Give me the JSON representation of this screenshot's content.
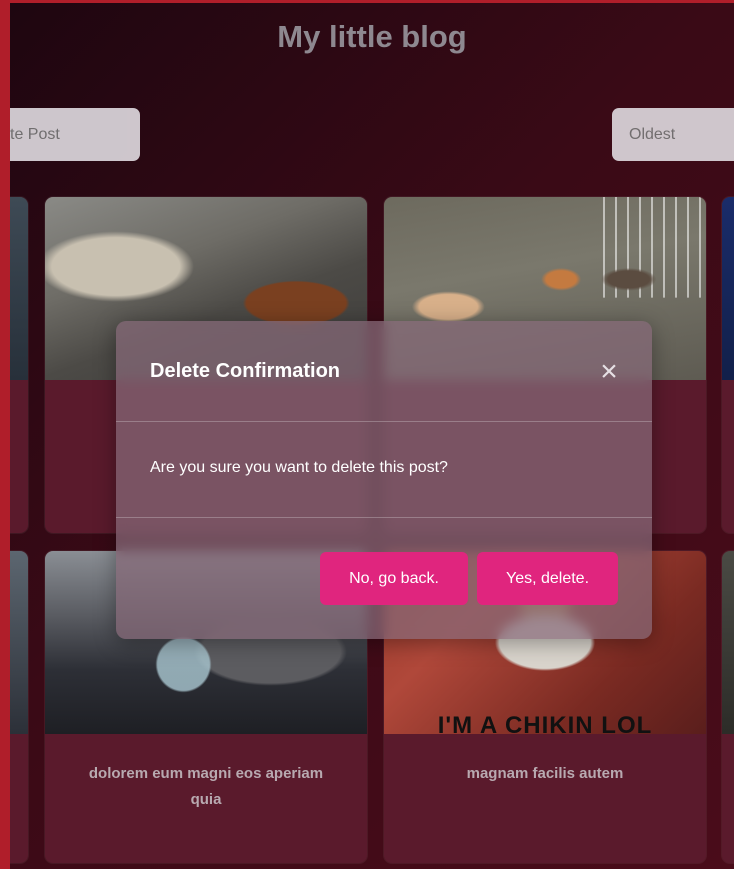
{
  "header": {
    "title": "My little blog"
  },
  "toolbar": {
    "create_label": "te Post",
    "sort_value": "Oldest"
  },
  "cards": [
    {
      "title": ""
    },
    {
      "title": ""
    },
    {
      "title": "dolorem eum magni eos aperiam quia"
    },
    {
      "title": "magnam facilis autem",
      "image_caption": "I'M A CHIKIN LOL"
    }
  ],
  "modal": {
    "title": "Delete Confirmation",
    "message": "Are you sure you want to delete this post?",
    "cancel_label": "No, go back.",
    "confirm_label": "Yes, delete.",
    "close_glyph": "×"
  },
  "colors": {
    "accent": "#e0257e",
    "frame": "#b01e2a"
  }
}
